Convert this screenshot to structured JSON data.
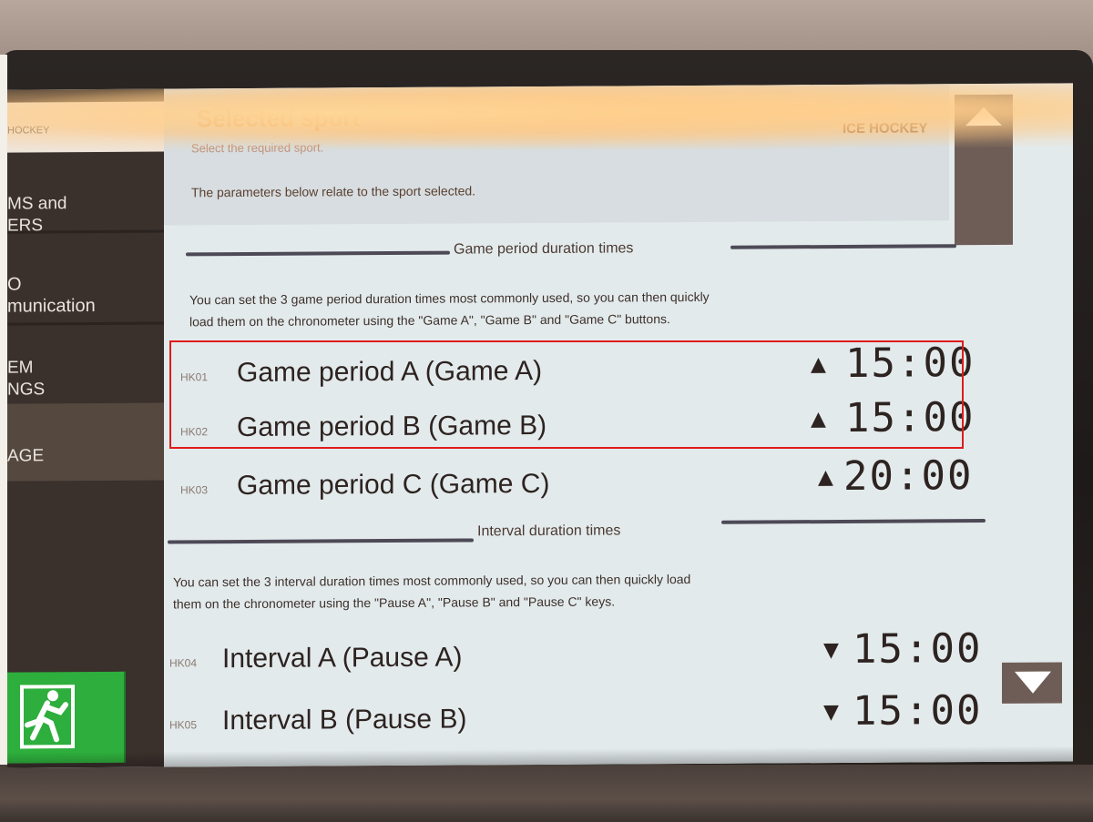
{
  "sidebar": {
    "top_label": "HOCKEY",
    "items": [
      {
        "label": "MS and\nERS"
      },
      {
        "label": "O\nmunication"
      },
      {
        "label": "EM\nNGS"
      },
      {
        "label": "AGE"
      }
    ],
    "exit_icon": "running-man-exit-icon"
  },
  "header": {
    "title": "Selected sport",
    "subtitle": "Select the required sport.",
    "sport_value": "ICE HOCKEY",
    "note": "The parameters below relate to the sport selected."
  },
  "game_section": {
    "heading": "Game period duration times",
    "description_line1": "You can set the 3 game period duration times most commonly used, so you can then quickly",
    "description_line2": "load them on the chronometer using the \"Game A\", \"Game B\" and \"Game C\" buttons.",
    "rows": [
      {
        "code": "HK01",
        "label": "Game period A (Game A)",
        "arrow": "▲",
        "value": "15:00"
      },
      {
        "code": "HK02",
        "label": "Game period B (Game B)",
        "arrow": "▲",
        "value": "15:00"
      },
      {
        "code": "HK03",
        "label": "Game period C (Game C)",
        "arrow": "▲",
        "value": "20:00"
      }
    ]
  },
  "interval_section": {
    "heading": "Interval duration times",
    "description_line1": "You can set the 3 interval duration times most commonly used, so you can then quickly load",
    "description_line2": "them on the chronometer using the \"Pause A\", \"Pause B\" and \"Pause C\" keys.",
    "rows": [
      {
        "code": "HK04",
        "label": "Interval A (Pause A)",
        "arrow": "▼",
        "value": "15:00"
      },
      {
        "code": "HK05",
        "label": "Interval B (Pause B)",
        "arrow": "▼",
        "value": "15:00"
      }
    ]
  },
  "colors": {
    "highlight": "#e01b1b",
    "exit_green": "#2eae3c",
    "sidebar_bg": "#3a302c",
    "scroll_bg": "#6e5d56"
  }
}
